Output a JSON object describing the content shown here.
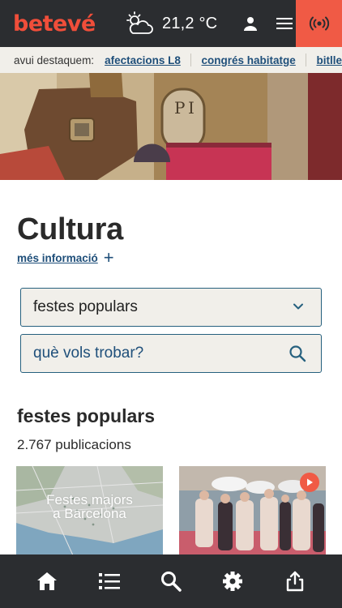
{
  "header": {
    "logo": "betevé",
    "weather_icon": "partly-cloudy-icon",
    "temperature": "21,2 °C",
    "user_icon": "user-icon",
    "menu_icon": "hamburger-menu-icon",
    "live_icon": "broadcast-icon"
  },
  "highlights": {
    "label": "avui destaquem:",
    "links": [
      "afectacions L8",
      "congrés habitatge",
      "bitlle"
    ]
  },
  "main": {
    "title": "Cultura",
    "more_info_label": "més informació",
    "more_info_icon": "plus-icon",
    "category_select": {
      "value": "festes populars",
      "icon": "chevron-down-icon"
    },
    "search": {
      "placeholder": "què vols trobar?",
      "icon": "search-icon"
    },
    "section_title": "festes populars",
    "publication_count": "2.767 publicacions",
    "cards": [
      {
        "overlay_text": "Festes majors\na Barcelona",
        "type": "map"
      },
      {
        "type": "video",
        "icon": "play-icon"
      }
    ]
  },
  "bottom_nav": {
    "items": [
      "home-icon",
      "list-icon",
      "search-icon",
      "settings-icon",
      "share-icon"
    ]
  },
  "colors": {
    "brand": "#f04e3a",
    "dark_bar": "#2b2d30",
    "link": "#1f4f7a",
    "input_bg": "#f1efea",
    "input_border": "#26607e"
  }
}
